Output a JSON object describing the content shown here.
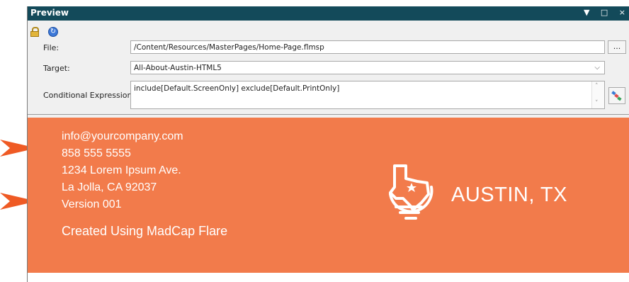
{
  "panel": {
    "title": "Preview",
    "window_controls": "▼ □ ×"
  },
  "toolbar": {
    "lock_icon": "lock-icon",
    "sync_icon": "sync-icon"
  },
  "form": {
    "file_label": "File:",
    "file_value": "/Content/Resources/MasterPages/Home-Page.flmsp",
    "browse_label": "...",
    "target_label": "Target:",
    "target_value": "All-About-Austin-HTML5",
    "condition_label": "Conditional Expression:",
    "condition_value": "include[Default.ScreenOnly] exclude[Default.PrintOnly]"
  },
  "footer": {
    "email": "info@yourcompany.com",
    "phone": "858 555 5555",
    "address1": "1234 Lorem Ipsum Ave.",
    "address2": "La Jolla, CA 92037",
    "version": "Version 001",
    "created": "Created Using MadCap Flare",
    "brand": "AUSTIN, TX"
  },
  "colors": {
    "titlebar": "#134a5a",
    "footer_bg": "#f27b4b",
    "arrow": "#ef5a24"
  }
}
